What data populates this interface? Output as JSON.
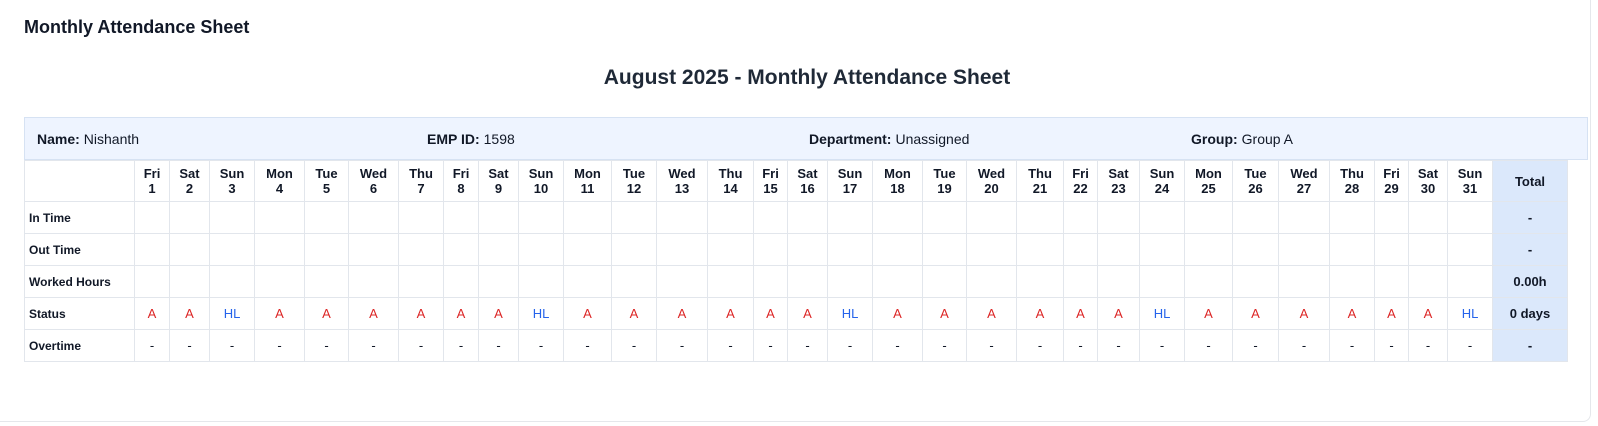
{
  "page_heading": "Monthly Attendance Sheet",
  "sheet_title": "August 2025 - Monthly Attendance Sheet",
  "employee": {
    "name_label": "Name:",
    "name": "Nishanth",
    "emp_id_label": "EMP ID:",
    "emp_id": "1598",
    "department_label": "Department:",
    "department": "Unassigned",
    "group_label": "Group:",
    "group": "Group A"
  },
  "total_header": "Total",
  "days": [
    {
      "dow": "Fri",
      "date": "1",
      "status": "A"
    },
    {
      "dow": "Sat",
      "date": "2",
      "status": "A"
    },
    {
      "dow": "Sun",
      "date": "3",
      "status": "HL"
    },
    {
      "dow": "Mon",
      "date": "4",
      "status": "A"
    },
    {
      "dow": "Tue",
      "date": "5",
      "status": "A"
    },
    {
      "dow": "Wed",
      "date": "6",
      "status": "A"
    },
    {
      "dow": "Thu",
      "date": "7",
      "status": "A"
    },
    {
      "dow": "Fri",
      "date": "8",
      "status": "A"
    },
    {
      "dow": "Sat",
      "date": "9",
      "status": "A"
    },
    {
      "dow": "Sun",
      "date": "10",
      "status": "HL"
    },
    {
      "dow": "Mon",
      "date": "11",
      "status": "A"
    },
    {
      "dow": "Tue",
      "date": "12",
      "status": "A"
    },
    {
      "dow": "Wed",
      "date": "13",
      "status": "A"
    },
    {
      "dow": "Thu",
      "date": "14",
      "status": "A"
    },
    {
      "dow": "Fri",
      "date": "15",
      "status": "A"
    },
    {
      "dow": "Sat",
      "date": "16",
      "status": "A"
    },
    {
      "dow": "Sun",
      "date": "17",
      "status": "HL"
    },
    {
      "dow": "Mon",
      "date": "18",
      "status": "A"
    },
    {
      "dow": "Tue",
      "date": "19",
      "status": "A"
    },
    {
      "dow": "Wed",
      "date": "20",
      "status": "A"
    },
    {
      "dow": "Thu",
      "date": "21",
      "status": "A"
    },
    {
      "dow": "Fri",
      "date": "22",
      "status": "A"
    },
    {
      "dow": "Sat",
      "date": "23",
      "status": "A"
    },
    {
      "dow": "Sun",
      "date": "24",
      "status": "HL"
    },
    {
      "dow": "Mon",
      "date": "25",
      "status": "A"
    },
    {
      "dow": "Tue",
      "date": "26",
      "status": "A"
    },
    {
      "dow": "Wed",
      "date": "27",
      "status": "A"
    },
    {
      "dow": "Thu",
      "date": "28",
      "status": "A"
    },
    {
      "dow": "Fri",
      "date": "29",
      "status": "A"
    },
    {
      "dow": "Sat",
      "date": "30",
      "status": "A"
    },
    {
      "dow": "Sun",
      "date": "31",
      "status": "HL"
    }
  ],
  "rows": [
    {
      "key": "in_time",
      "label": "In Time",
      "total": "-"
    },
    {
      "key": "out_time",
      "label": "Out Time",
      "total": "-"
    },
    {
      "key": "worked_hours",
      "label": "Worked Hours",
      "total": "0.00h"
    },
    {
      "key": "status",
      "label": "Status",
      "total": "0 days"
    },
    {
      "key": "overtime",
      "label": "Overtime",
      "total": "-"
    }
  ],
  "overtime_value": "-",
  "status_colors": {
    "A": "#dc2626",
    "HL": "#2563eb"
  }
}
